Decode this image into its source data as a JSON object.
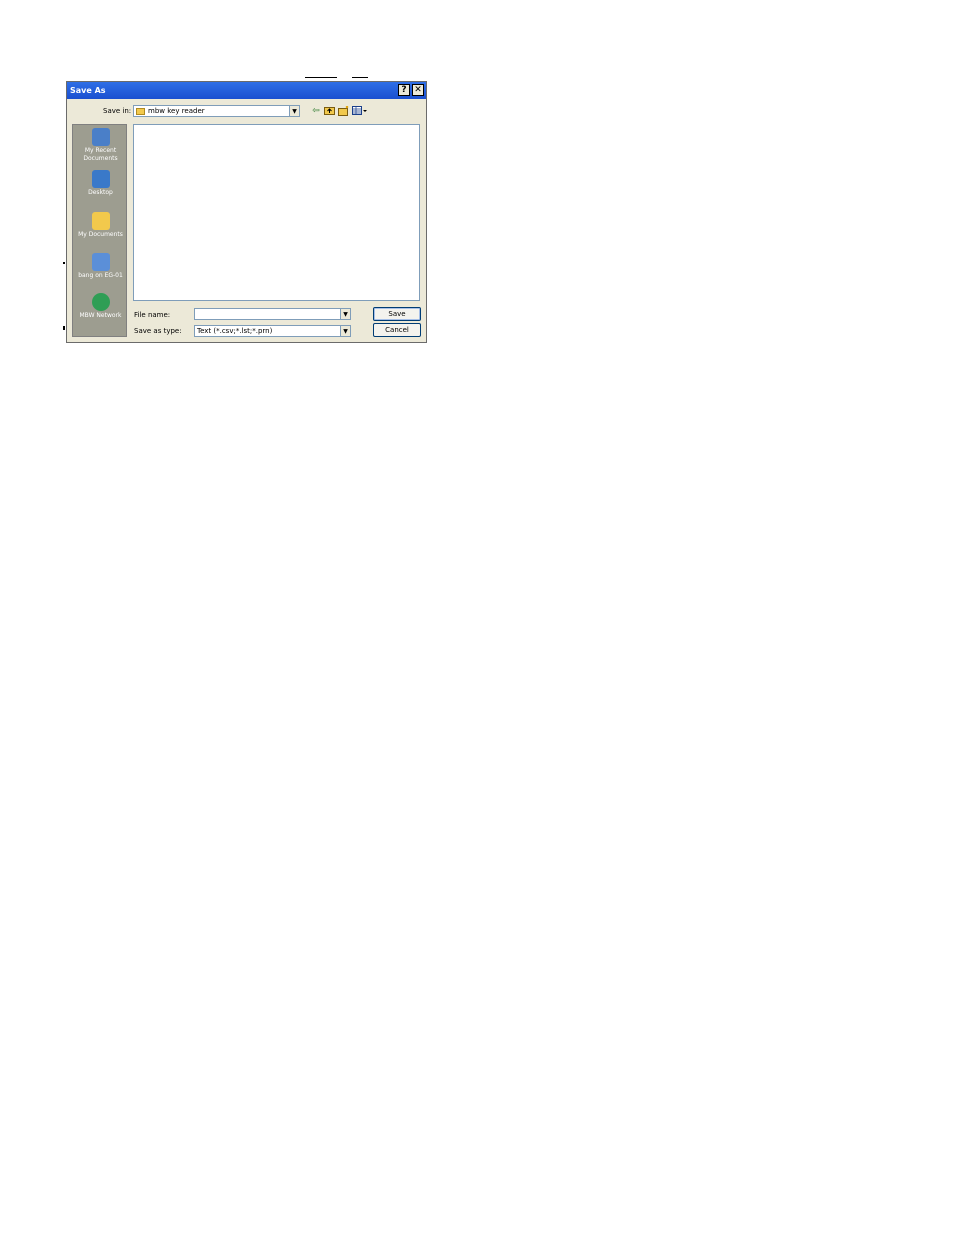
{
  "dialog": {
    "title": "Save As",
    "help_icon": "?",
    "close_icon": "✕",
    "save_in_label": "Save in:",
    "save_in_value": "mbw key reader",
    "toolbar_icons": [
      "back-icon",
      "up-folder-icon",
      "new-folder-icon",
      "views-menu-icon"
    ],
    "places": [
      {
        "label": "My Recent Documents",
        "icon": "recent-documents-icon",
        "color": "#4a7fc8"
      },
      {
        "label": "Desktop",
        "icon": "desktop-icon",
        "color": "#3a79c9"
      },
      {
        "label": "My Documents",
        "icon": "my-documents-icon",
        "color": "#f2c94c"
      },
      {
        "label": "bang on EG-01",
        "icon": "computer-icon",
        "color": "#5b8fd8"
      },
      {
        "label": "MBW Network",
        "icon": "network-icon",
        "color": "#2f9e55"
      }
    ],
    "file_name_label": "File name:",
    "file_name_value": "",
    "save_as_type_label": "Save as type:",
    "save_as_type_value": "Text (*.csv;*.lst;*.prn)",
    "save_button": "Save",
    "cancel_button": "Cancel"
  }
}
